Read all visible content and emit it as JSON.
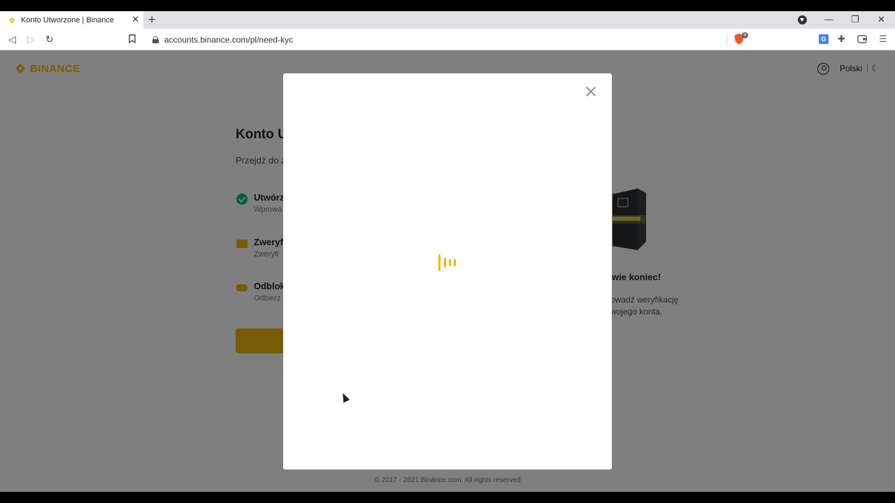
{
  "browser": {
    "tab_title": "Konto Utworzone | Binance",
    "url": "accounts.binance.com/pl/need-kyc",
    "brave_badge": "4"
  },
  "header": {
    "logo_text": "BINANCE",
    "language": "Polski"
  },
  "page": {
    "title": "Konto U",
    "subtitle": "Przejdź do z",
    "steps": [
      {
        "label": "Utwórz",
        "desc": "Wprowa",
        "icon": "check-circle-icon"
      },
      {
        "label": "Zweryf",
        "desc": "Zweryfi",
        "icon": "id-card-icon"
      },
      {
        "label": "Odblok",
        "desc": "Odbierz",
        "icon": "unlock-icon"
      }
    ],
    "right_heading": "wie koniec!",
    "right_desc_line1": "owadź weryfikację",
    "right_desc_line2": "wojego konta.",
    "footer": "© 2017 - 2021 Binance.com. All rights reserved"
  },
  "colors": {
    "brand": "#f0b90b",
    "success": "#02c076",
    "overlay": "rgba(0,0,0,0.5)"
  },
  "modal": {
    "state": "loading",
    "loader_icon": "loading-bars-icon"
  }
}
